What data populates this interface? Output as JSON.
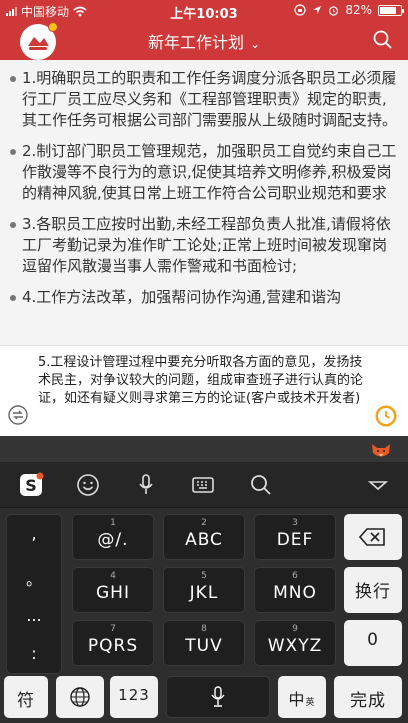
{
  "status": {
    "carrier": "中国移动",
    "time": "上午10:03",
    "battery": "82%",
    "battery_level": 0.82
  },
  "nav": {
    "title": "新年工作计划"
  },
  "document": {
    "items": [
      "1.明确职员工的职责和工作任务调度分派各职员工必须履行工厂员工应尽义务和《工程部管理职责》规定的职责,其工作任务可根据公司部门需要服从上级随时调配支持。",
      "2.制订部门职员工管理规范，加强职员工自觉约束自己工作散漫等不良行为的意识,促使其培养文明修养,积极爱岗的精神风貌,使其日常上班工作符合公司职业规范和要求",
      "3.各职员工应按时出勤,未经工程部负责人批准,请假将依工厂考勤记录为准作旷工论处;正常上班时间被发现窜岗逗留作风散漫当事人需作警戒和书面检讨;",
      "4.工作方法改革，加强帮问协作沟通,营建和谐沟"
    ]
  },
  "input": {
    "text": "5.工程设计管理过程中要充分听取各方面的意见，发扬技术民主，对争议较大的问题，组成审查班子进行认真的论证，如还有疑义则寻求第三方的论证(客户或技术开发者)"
  },
  "keyboard": {
    "punctuation": [
      ",",
      "。",
      "...",
      ":"
    ],
    "keys": [
      {
        "num": "1",
        "label": "@/."
      },
      {
        "num": "2",
        "label": "ABC"
      },
      {
        "num": "3",
        "label": "DEF"
      },
      {
        "num": "4",
        "label": "GHI"
      },
      {
        "num": "5",
        "label": "JKL"
      },
      {
        "num": "6",
        "label": "MNO"
      },
      {
        "num": "7",
        "label": "PQRS"
      },
      {
        "num": "8",
        "label": "TUV"
      },
      {
        "num": "9",
        "label": "WXYZ"
      }
    ],
    "newline": "换行",
    "zero": "0",
    "symbol": "符",
    "numbers": "123",
    "lang": "中",
    "lang_alt": "英",
    "done": "完成"
  },
  "icons": {
    "app_logo": "app-logo-icon",
    "search": "search-icon",
    "sogou": "sogou-logo-icon",
    "emoji": "emoji-icon",
    "voice": "microphone-icon",
    "keyboard": "keyboard-icon",
    "kb_search": "search-icon",
    "collapse": "chevron-down-icon",
    "delete": "backspace-icon",
    "globe": "globe-icon",
    "fox": "fox-mascot-icon"
  },
  "colors": {
    "brand_red": "#cf3838",
    "sogou_orange": "#e95a24",
    "clock_orange": "#f0a21a"
  }
}
